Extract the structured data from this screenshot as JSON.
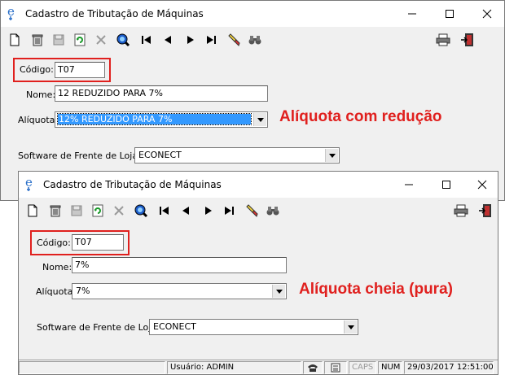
{
  "windows": [
    {
      "title": "Cadastro de Tributação de Máquinas",
      "form": {
        "codigo_label": "Código:",
        "codigo_value": "T07",
        "nome_label": "Nome:",
        "nome_value": "12 REDUZIDO PARA 7%",
        "aliquota_label": "Alíquota:",
        "aliquota_value": "12% REDUZIDO PARA 7%",
        "software_label": "Software de Frente de Loja:",
        "software_value": "ECONECT"
      },
      "annotation": "Alíquota com redução"
    },
    {
      "title": "Cadastro de Tributação de Máquinas",
      "form": {
        "codigo_label": "Código:",
        "codigo_value": "T07",
        "nome_label": "Nome:",
        "nome_value": "7%",
        "aliquota_label": "Alíquota:",
        "aliquota_value": "7%",
        "software_label": "Software de Frente de Loja:",
        "software_value": "ECONECT"
      },
      "annotation": "Alíquota cheia (pura)",
      "statusbar": {
        "user": "Usuário: ADMIN",
        "caps": "CAPS",
        "num": "NUM",
        "datetime": "29/03/2017 12:51:00"
      }
    }
  ],
  "toolbar_icons": [
    "new-document-icon",
    "delete-trash-icon",
    "save-icon",
    "refresh-icon",
    "cancel-x-icon",
    "search-globe-icon",
    "first-record-icon",
    "previous-record-icon",
    "next-record-icon",
    "last-record-icon",
    "clear-filter-icon",
    "binoculars-icon",
    "printer-icon",
    "exit-door-icon"
  ],
  "colors": {
    "annotation_red": "#e0201e",
    "selection_blue": "#3399ff",
    "window_face": "#f0f0f0"
  }
}
